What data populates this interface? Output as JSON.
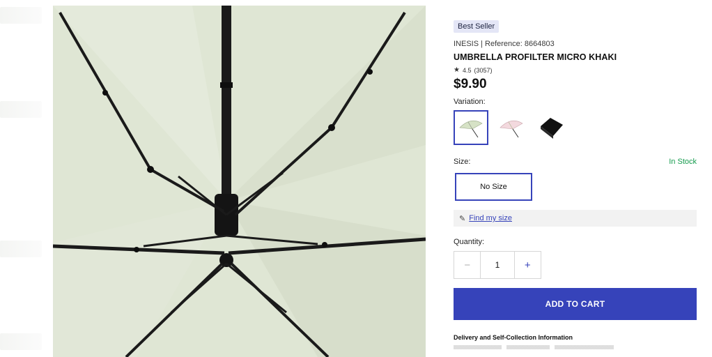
{
  "product": {
    "badge": "Best Seller",
    "reference_line": "INESIS | Reference: 8664803",
    "title": "UMBRELLA PROFILTER MICRO KHAKI",
    "rating_star": "★",
    "rating_value": "4.5",
    "rating_count": "(3057)",
    "price": "$9.90"
  },
  "variation": {
    "label": "Variation:",
    "options": [
      {
        "name": "khaki",
        "selected": true,
        "color": "#d6e2c6"
      },
      {
        "name": "pink",
        "selected": false,
        "color": "#f3d9de"
      },
      {
        "name": "black",
        "selected": false,
        "color": "#111111"
      }
    ]
  },
  "size": {
    "label": "Size:",
    "stock_status": "In Stock",
    "selected_option": "No Size"
  },
  "find_size": {
    "icon": "pencil-icon",
    "link_text": "Find my size"
  },
  "quantity": {
    "label": "Quantity:",
    "minus": "−",
    "value": "1",
    "plus": "+"
  },
  "cart": {
    "button_label": "ADD TO CART"
  },
  "delivery": {
    "heading": "Delivery and Self-Collection Information"
  },
  "colors": {
    "accent": "#3643ba",
    "in_stock": "#149b4d",
    "canopy": "#dfe6d4"
  }
}
